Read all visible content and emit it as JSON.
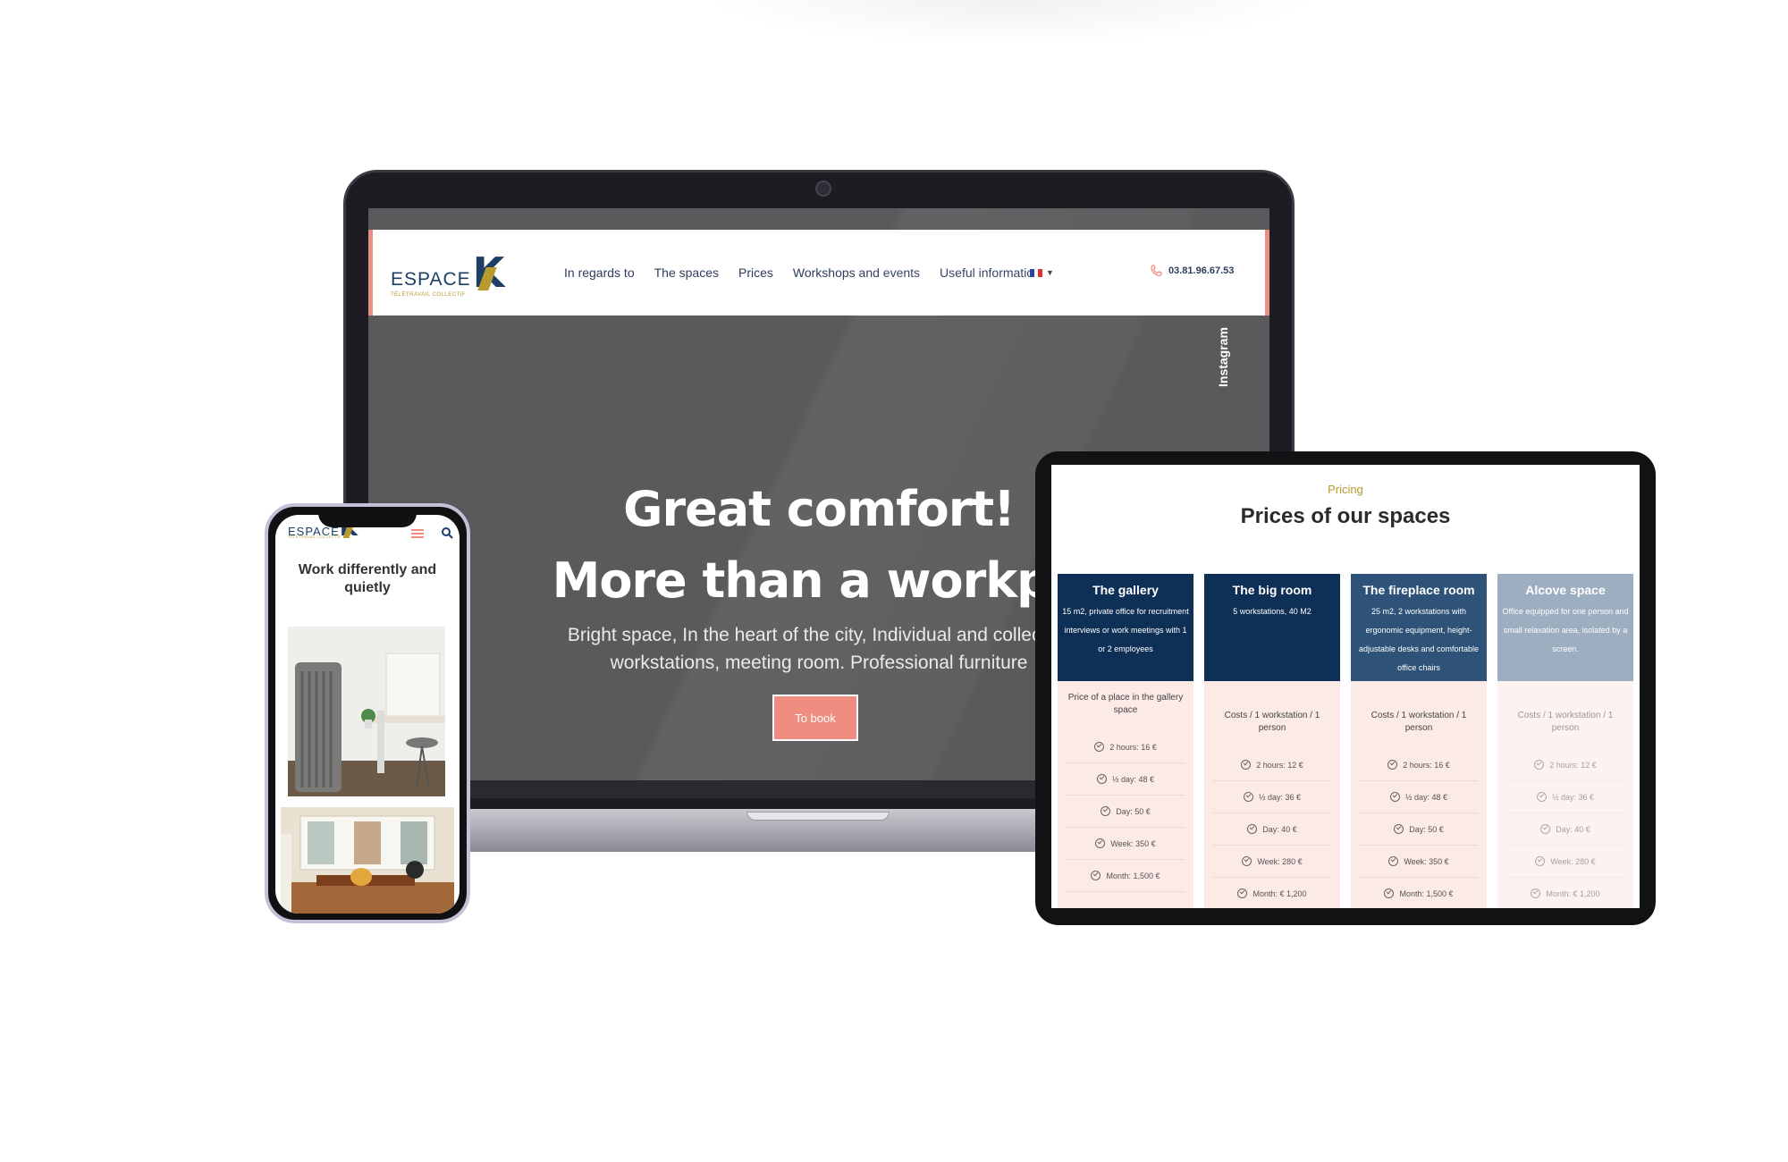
{
  "laptop": {
    "logo": {
      "word": "ESPACE",
      "letter": "K",
      "tagline": "TÉLÉTRAVAIL COLLECTIF"
    },
    "nav": [
      "In regards to",
      "The spaces",
      "Prices",
      "Workshops and events",
      "Useful information"
    ],
    "language": {
      "flag": "fr-flag",
      "colors": [
        "#1f3f99",
        "#ffffff",
        "#e0262b"
      ]
    },
    "phone_number": "03.81.96.67.53",
    "social": "Instagram",
    "hero": {
      "title_line1": "Great comfort!",
      "title_line2": "More than a workplace",
      "subtitle_line1": "Bright space, In the heart of the city, Individual and collective",
      "subtitle_line2": "workstations, meeting room. Professional furniture",
      "cta": "To book"
    }
  },
  "phone": {
    "logo": {
      "word": "ESPACE",
      "letter": "K",
      "tagline": "TÉLÉTRAVAIL COLLECTIF"
    },
    "heading": "Work differently and quietly"
  },
  "tablet": {
    "kicker": "Pricing",
    "title": "Prices of our spaces",
    "cards": [
      {
        "title": "The gallery",
        "description": "15 m2, private office for recruitment interviews or work meetings with 1 or 2 employees",
        "header_color": "#0e2f56",
        "subtitle": "Price of a place in the gallery space",
        "prices": [
          "2 hours: 16 €",
          "½ day: 48 €",
          "Day: 50 €",
          "Week: 350 €",
          "Month: 1,500 €"
        ]
      },
      {
        "title": "The big room",
        "description": "5 workstations, 40 M2",
        "header_color": "#0e2f56",
        "subtitle": "Costs / 1 workstation / 1 person",
        "prices": [
          "2 hours: 12 €",
          "½ day: 36 €",
          "Day: 40 €",
          "Week: 280 €",
          "Month: € 1,200"
        ]
      },
      {
        "title": "The fireplace room",
        "description": "25 m2, 2 workstations with ergonomic equipment, height-adjustable desks and comfortable office chairs",
        "header_color": "#2e5278",
        "subtitle": "Costs / 1 workstation / 1 person",
        "prices": [
          "2 hours: 16 €",
          "½ day: 48 €",
          "Day: 50 €",
          "Week: 350 €",
          "Month: 1,500 €"
        ]
      },
      {
        "title": "Alcove space",
        "description": "Office equipped for one person and small relaxation area, isolated by a screen.",
        "header_color": "#4d6c8e",
        "subtitle": "Costs / 1 workstation / 1 person",
        "prices": [
          "2 hours: 12 €",
          "½ day: 36 €",
          "Day: 40 €",
          "Week: 280 €",
          "Month: € 1,200"
        ]
      }
    ]
  },
  "colors": {
    "accent": "#ef8d81",
    "navy": "#1d3f66",
    "gold": "#b89a2e",
    "hero_bg": "#5a5a5c"
  }
}
